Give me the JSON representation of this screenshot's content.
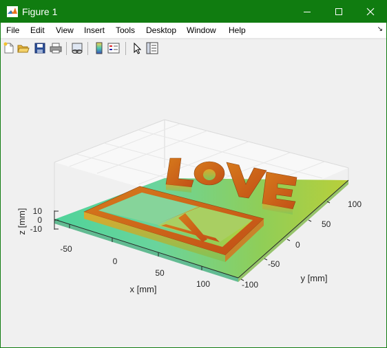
{
  "window": {
    "title": "Figure 1",
    "titlebar_color": "#107c10",
    "controls": [
      "minimize-icon",
      "maximize-icon",
      "close-icon"
    ]
  },
  "menu": {
    "file": "File",
    "edit": "Edit",
    "view": "View",
    "insert": "Insert",
    "tools": "Tools",
    "desktop": "Desktop",
    "window": "Window",
    "help": "Help"
  },
  "toolbar": {
    "icons": [
      "new-figure-icon",
      "open-file-icon",
      "save-icon",
      "print-icon",
      "link-plot-icon",
      "colorbar-icon",
      "legend-icon",
      "edit-plot-arrow-icon",
      "property-inspector-icon"
    ]
  },
  "plot": {
    "type": "3d-surface",
    "colormap_colors": [
      "#5ad8a0",
      "#b8c830",
      "#d87a18",
      "#c8501a"
    ],
    "x_axis": {
      "label": "x [mm]",
      "ticks": [
        "-50",
        "0",
        "50",
        "100"
      ]
    },
    "y_axis": {
      "label": "y [mm]",
      "ticks": [
        "-100",
        "-50",
        "0",
        "50",
        "100"
      ]
    },
    "z_axis": {
      "label": "z [mm]",
      "ticks": [
        "-10",
        "0",
        "10"
      ]
    }
  }
}
